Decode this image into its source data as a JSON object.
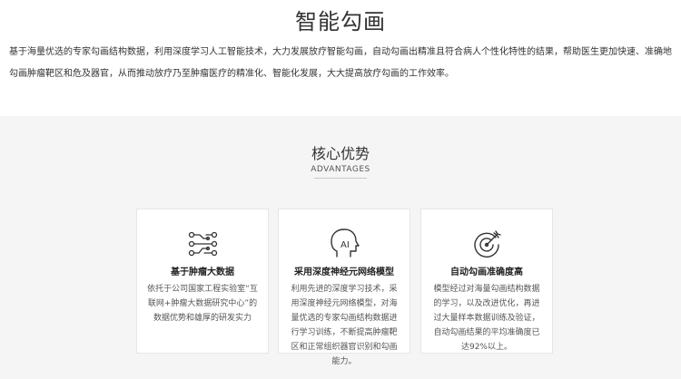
{
  "page_title": "智能勾画",
  "intro": "基于海量优选的专家勾画结构数据，利用深度学习人工智能技术，大力发展放疗智能勾画，自动勾画出精准且符合病人个性化特性的结果，帮助医生更加快速、准确地勾画肿瘤靶区和危及器官，从而推动放疗乃至肿瘤医疗的精准化、智能化发展，大大提高放疗勾画的工作效率。",
  "advantages": {
    "title": "核心优势",
    "subtitle": "ADVANTAGES",
    "cards": [
      {
        "icon": "circuit-icon",
        "title": "基于肿瘤大数据",
        "desc": "依托于公司国家工程实验室“互联网+肿瘤大数据研究中心”的数据优势和雄厚的研发实力"
      },
      {
        "icon": "ai-head-icon",
        "icon_text": "AI",
        "title": "采用深度神经元网络模型",
        "desc": "利用先进的深度学习技术，采用深度神经元网络模型，对海量优选的专家勾画结构数据进行学习训练，不断提高肿瘤靶区和正常组织器官识别和勾画能力。"
      },
      {
        "icon": "target-icon",
        "title": "自动勾画准确度高",
        "desc": "模型经过对海量勾画结构数据的学习，以及改进优化，再进过大量样本数据训练及验证，自动勾画结果的平均准确度已达92%以上。"
      }
    ]
  }
}
